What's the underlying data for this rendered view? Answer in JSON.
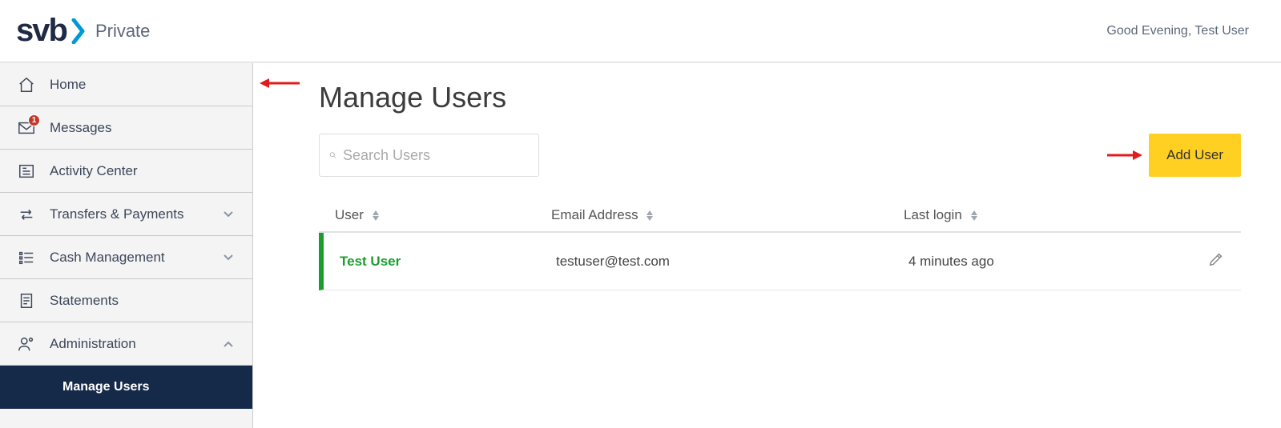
{
  "header": {
    "logo_text": "svb",
    "logo_suffix": "Private",
    "greeting": "Good Evening, Test User"
  },
  "sidebar": {
    "items": [
      {
        "label": "Home"
      },
      {
        "label": "Messages",
        "badge": "1"
      },
      {
        "label": "Activity Center"
      },
      {
        "label": "Transfers & Payments"
      },
      {
        "label": "Cash Management"
      },
      {
        "label": "Statements"
      },
      {
        "label": "Administration"
      }
    ],
    "sub": {
      "label": "Manage Users"
    }
  },
  "main": {
    "title": "Manage Users",
    "search_placeholder": "Search Users",
    "add_button": "Add User",
    "columns": {
      "user": "User",
      "email": "Email Address",
      "login": "Last login"
    },
    "rows": [
      {
        "user": "Test User",
        "email": "testuser@test.com",
        "login": "4 minutes ago"
      }
    ]
  }
}
